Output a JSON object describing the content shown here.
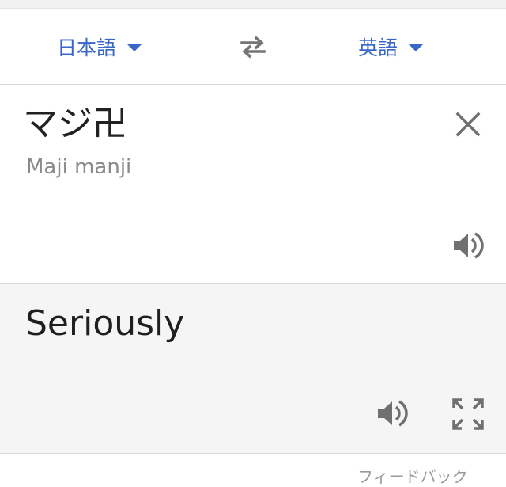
{
  "languages": {
    "source": "日本語",
    "target": "英語"
  },
  "input": {
    "text": "マジ卍",
    "romanization": "Maji manji"
  },
  "output": {
    "text": "Seriously"
  },
  "footer": {
    "feedback": "フィードバック"
  },
  "icons": {
    "swap": "swap-arrows-icon",
    "clear": "close-icon",
    "speak": "speaker-icon",
    "fullscreen": "fullscreen-icon",
    "dropdown": "caret-down-icon"
  },
  "colors": {
    "accent": "#3a66c9",
    "icon_gray": "#757575",
    "output_bg": "#f5f5f5"
  }
}
